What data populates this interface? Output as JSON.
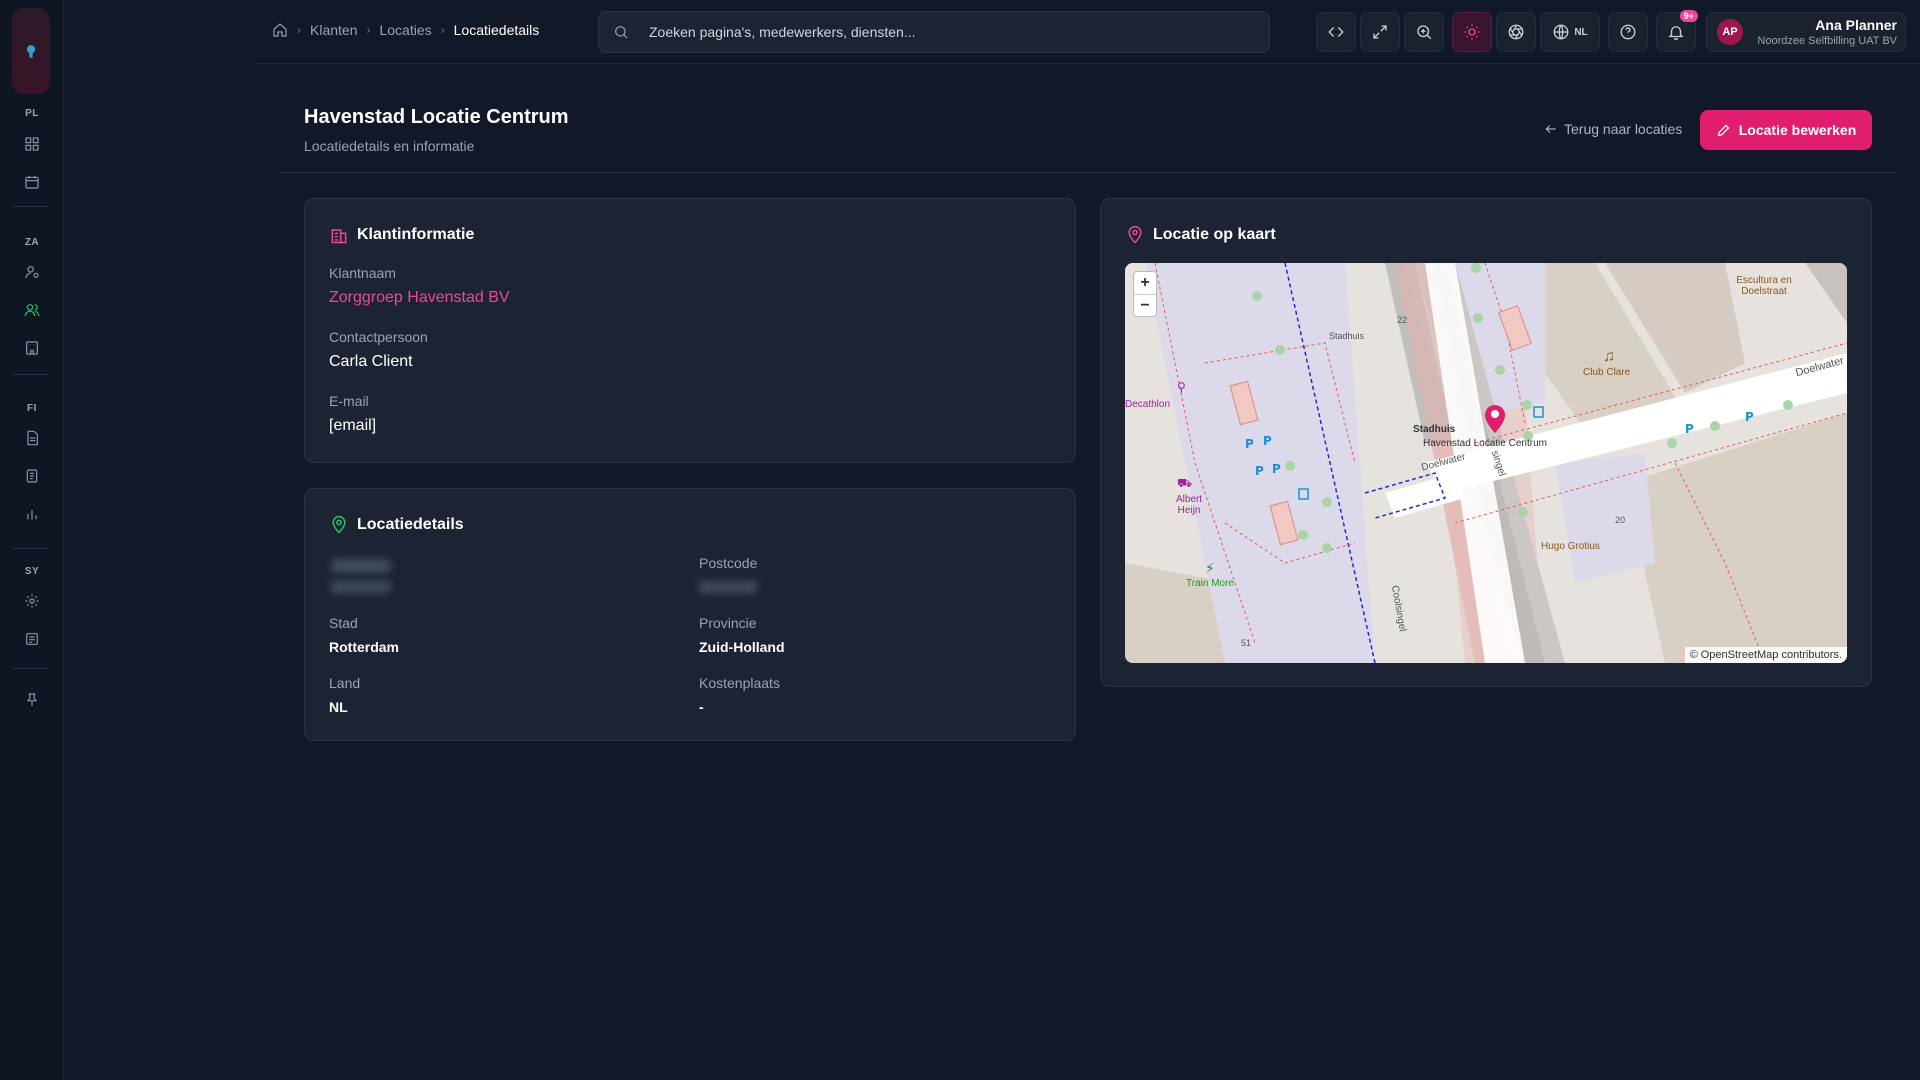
{
  "breadcrumbs": [
    "Klanten",
    "Locaties",
    "Locatiedetails"
  ],
  "search": {
    "placeholder": "Zoeken pagina's, medewerkers, diensten..."
  },
  "topbar": {
    "language": "NL",
    "notifications_badge": "9+"
  },
  "user": {
    "initials": "AP",
    "name": "Ana Planner",
    "org": "Noordzee Selfbilling UAT BV"
  },
  "sidebar": {
    "sections": [
      "PL",
      "ZA",
      "FI",
      "SY"
    ]
  },
  "page": {
    "title": "Havenstad Locatie Centrum",
    "subtitle": "Locatiedetails en informatie",
    "back_label": "Terug naar locaties",
    "edit_label": "Locatie bewerken"
  },
  "client_card": {
    "title": "Klantinformatie",
    "client_name_label": "Klantnaam",
    "client_name": "Zorggroep Havenstad BV",
    "contact_label": "Contactpersoon",
    "contact": "Carla Client",
    "email_label": "E-mail",
    "email": "[email]"
  },
  "location_card": {
    "title": "Locatiedetails",
    "postcode_label": "Postcode",
    "city_label": "Stad",
    "city": "Rotterdam",
    "province_label": "Provincie",
    "province": "Zuid-Holland",
    "country_label": "Land",
    "country": "NL",
    "cost_center_label": "Kostenplaats",
    "cost_center": "-"
  },
  "map_card": {
    "title": "Locatie op kaart",
    "marker_label": "Havenstad Locatie Centrum",
    "attribution": "© OpenStreetMap contributors.",
    "labels": {
      "doelwater_1": "Doelwater",
      "doelwater_2": "Doelwater",
      "coolsingel": "Coolsingel",
      "stadhuis": "Stadhuis",
      "stadhuis_small": "Stadhuis",
      "club_clare": "Club Clare",
      "decathlon": "Decathlon",
      "albert_heijn": "Albert Heijn",
      "train_more": "Train More",
      "hugo_grotius": "Hugo Grotius",
      "escultura": "Escultura en Doelstraat",
      "n22": "22",
      "n20": "20",
      "n51": "51"
    }
  },
  "colors": {
    "accent": "#e11d6e",
    "pink": "#ec4899",
    "green": "#22c55e",
    "bg": "#111827",
    "card": "#1c2433"
  }
}
